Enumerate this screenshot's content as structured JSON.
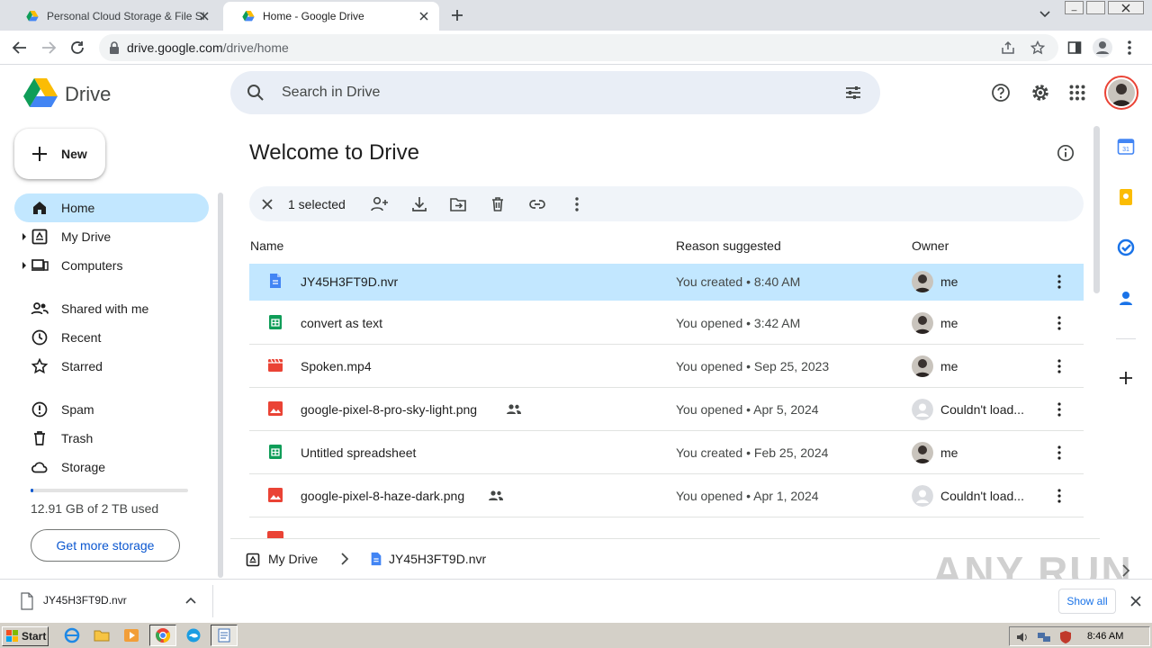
{
  "browser": {
    "tabs": [
      {
        "title": "Personal Cloud Storage & File Sharin",
        "active": false
      },
      {
        "title": "Home - Google Drive",
        "active": true
      }
    ],
    "url_host": "drive.google.com",
    "url_path": "/drive/home"
  },
  "app": {
    "name": "Drive",
    "search_placeholder": "Search in Drive",
    "new_label": "New"
  },
  "sidebar": {
    "items": [
      {
        "label": "Home",
        "icon": "home-icon",
        "active": true
      },
      {
        "label": "My Drive",
        "icon": "my-drive-icon",
        "expandable": true
      },
      {
        "label": "Computers",
        "icon": "computer-icon",
        "expandable": true
      },
      {
        "label": "Shared with me",
        "icon": "people-icon"
      },
      {
        "label": "Recent",
        "icon": "clock-icon"
      },
      {
        "label": "Starred",
        "icon": "star-icon"
      },
      {
        "label": "Spam",
        "icon": "spam-icon"
      },
      {
        "label": "Trash",
        "icon": "trash-icon"
      },
      {
        "label": "Storage",
        "icon": "cloud-icon"
      }
    ],
    "storage_text": "12.91 GB of 2 TB used",
    "storage_fraction": 0.0065,
    "more_storage": "Get more storage"
  },
  "main": {
    "title": "Welcome to Drive",
    "selection_count": "1 selected",
    "columns": {
      "name": "Name",
      "reason": "Reason suggested",
      "owner": "Owner"
    },
    "files": [
      {
        "name": "JY45H3FT9D.nvr",
        "type": "doc",
        "reason": "You created • 8:40 AM",
        "owner": "me",
        "selected": true,
        "shared": false
      },
      {
        "name": "convert as text",
        "type": "sheet",
        "reason": "You opened • 3:42 AM",
        "owner": "me",
        "selected": false,
        "shared": false
      },
      {
        "name": "Spoken.mp4",
        "type": "video",
        "reason": "You opened • Sep 25, 2023",
        "owner": "me",
        "selected": false,
        "shared": false
      },
      {
        "name": "google-pixel-8-pro-sky-light.png",
        "type": "image",
        "reason": "You opened • Apr 5, 2024",
        "owner": "Couldn't load...",
        "selected": false,
        "shared": true
      },
      {
        "name": "Untitled spreadsheet",
        "type": "sheet",
        "reason": "You created • Feb 25, 2024",
        "owner": "me",
        "selected": false,
        "shared": false
      },
      {
        "name": "google-pixel-8-haze-dark.png",
        "type": "image",
        "reason": "You opened • Apr 1, 2024",
        "owner": "Couldn't load...",
        "selected": false,
        "shared": true
      }
    ],
    "breadcrumb": {
      "root": "My Drive",
      "file": "JY45H3FT9D.nvr"
    }
  },
  "downloads": {
    "file": "JY45H3FT9D.nvr",
    "show_all": "Show all"
  },
  "watermark": "ANY RUN",
  "taskbar": {
    "start": "Start",
    "clock": "8:46 AM"
  },
  "colors": {
    "accent": "#0b57d0",
    "selected_row": "#c2e7ff",
    "doc": "#4285f4",
    "sheet": "#0f9d58",
    "media": "#ea4335"
  }
}
